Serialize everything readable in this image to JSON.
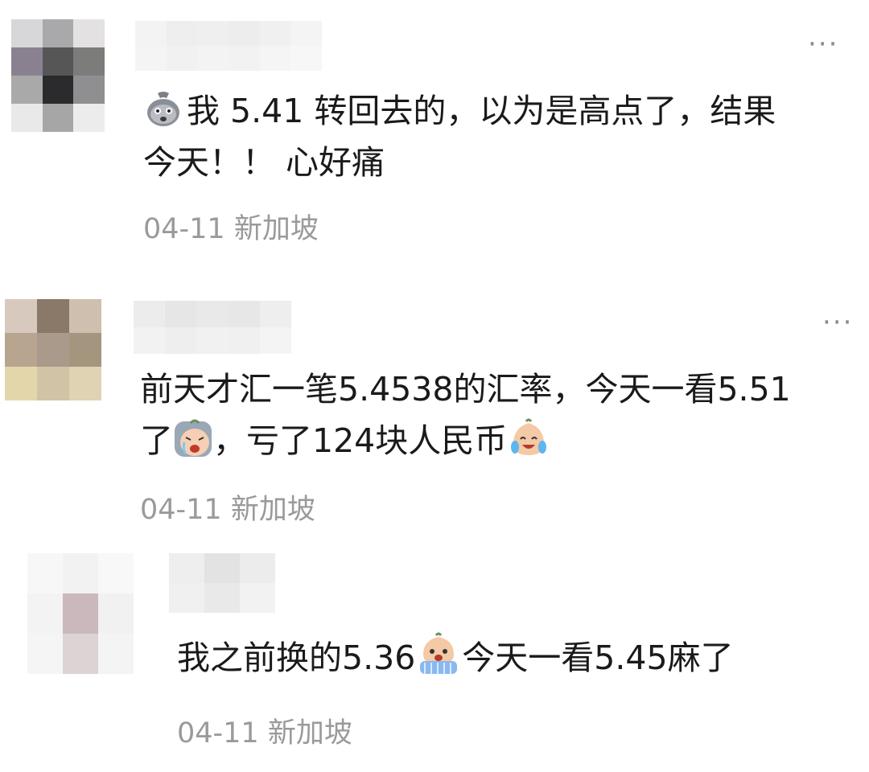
{
  "comments": [
    {
      "more_label": "···",
      "parts": {
        "emoji_before": "moneybag-sad-emoji",
        "line1": "我 5.41 转回去的，以为是高点了，结果",
        "line2": "今天！！ 心好痛"
      },
      "date": "04-11",
      "location": "新加坡"
    },
    {
      "more_label": "···",
      "parts": {
        "line1": "前天才汇一笔5.4538的汇率，今天一看5.51",
        "line2_a": "了",
        "emoji_mid": "crying-face-emoji",
        "line2_b": "，亏了124块人民币",
        "emoji_end": "tears-of-joy-emoji"
      },
      "date": "04-11",
      "location": "新加坡"
    },
    {
      "parts": {
        "line1_a": "我之前换的5.36",
        "emoji_mid": "crying-waterfall-emoji",
        "line1_b": "今天一看5.45麻了"
      },
      "date": "04-11",
      "location": "新加坡"
    }
  ],
  "colors": {
    "text": "#1a1a1a",
    "meta": "#9a9a9a",
    "more": "#8a8a8a",
    "background": "#ffffff"
  }
}
